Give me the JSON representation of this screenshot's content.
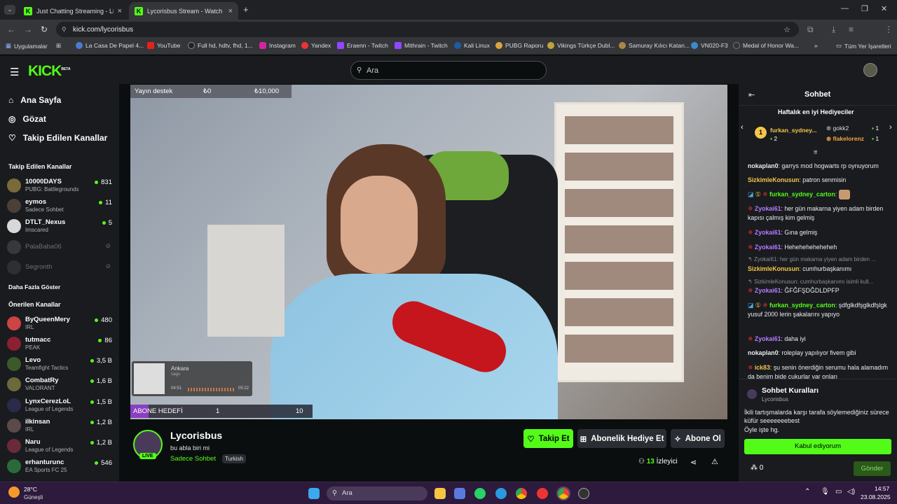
{
  "browser": {
    "tabs": [
      {
        "title": "Just Chatting Streaming - Live S",
        "active": false
      },
      {
        "title": "Lycorisbus Stream - Watch Live",
        "active": true
      }
    ],
    "url": "kick.com/lycorisbus",
    "bookmarks": [
      "Uygulamalar",
      "La Casa De Papel 4...",
      "YouTube",
      "Full hd, hdtv, fhd, 1...",
      "Instagram",
      "Yandex",
      "Eraenn - Twitch",
      "Mithrain - Twitch",
      "Kali Linux",
      "PUBG Raporu",
      "Vikings Türkçe Dubl...",
      "Samuray Kılıcı Katan...",
      "VN020-F3",
      "Medal of Honor Wa..."
    ],
    "bookmarks_more": "»",
    "all_bookmarks": "Tüm Yer İşaretleri"
  },
  "header": {
    "logo": "KICK",
    "logo_badge": "BETA",
    "search_placeholder": "Ara"
  },
  "sidebar": {
    "nav": [
      {
        "label": "Ana Sayfa",
        "icon": "home-icon"
      },
      {
        "label": "Gözat",
        "icon": "compass-icon"
      },
      {
        "label": "Takip Edilen Kanallar",
        "icon": "heart-icon"
      }
    ],
    "followed_title": "Takip Edilen Kanallar",
    "followed": [
      {
        "name": "10000DAYS",
        "category": "PUBG: Battlegrounds",
        "viewers": "831",
        "color": "#7a6a3a"
      },
      {
        "name": "eymos",
        "category": "Sadece Sohbet",
        "viewers": "11",
        "color": "#4a4036"
      },
      {
        "name": "DTLT_Nexus",
        "category": "Imscared",
        "viewers": "5",
        "color": "#d8d8d8"
      },
      {
        "name": "PalaBaba06",
        "category": "",
        "viewers": "",
        "color": "#555"
      },
      {
        "name": "Segronth",
        "category": "",
        "viewers": "",
        "color": "#444"
      }
    ],
    "show_more": "Daha Fazla Göster",
    "recommended_title": "Önerilen Kanallar",
    "recommended": [
      {
        "name": "ByQueenMery",
        "category": "IRL",
        "viewers": "480",
        "color": "#c44"
      },
      {
        "name": "tutmacc",
        "category": "PEAK",
        "viewers": "86",
        "color": "#8a2030"
      },
      {
        "name": "Levo",
        "category": "Teamfight Tactics",
        "viewers": "3,5 B",
        "color": "#3a5a2a"
      },
      {
        "name": "CombatRy",
        "category": "VALORANT",
        "viewers": "1,6 B",
        "color": "#6a6a3a"
      },
      {
        "name": "LynxCerezLoL",
        "category": "League of Legends",
        "viewers": "1,5 B",
        "color": "#2a2a4a"
      },
      {
        "name": "ilkinsan",
        "category": "IRL",
        "viewers": "1,2 B",
        "color": "#5a4a4a"
      },
      {
        "name": "Naru",
        "category": "League of Legends",
        "viewers": "1,2 B",
        "color": "#6a2a3a"
      },
      {
        "name": "erhanturunc",
        "category": "EA Sports FC 25",
        "viewers": "546",
        "color": "#2a6a3a"
      }
    ]
  },
  "video": {
    "donation_label": "Yayın destek",
    "donation_current": "₺0",
    "donation_goal": "₺10,000",
    "song_title": "Ankara",
    "song_artist": "sagu",
    "song_elapsed": "04:51",
    "song_total": "05:22",
    "sub_goal_label": "ABONE HEDEFİ",
    "sub_goal_current": "1",
    "sub_goal_target": "10"
  },
  "stream": {
    "channel": "Lycorisbus",
    "title": "bu abla biri mi",
    "category": "Sadece Sohbet",
    "language": "Turkish",
    "live_badge": "LIVE",
    "viewers": "13",
    "viewers_label": "İzleyici",
    "follow_btn": "Takip Et",
    "gift_btn": "Abonelik Hediye Et",
    "sub_btn": "Abone Ol"
  },
  "chat": {
    "title": "Sohbet",
    "gifters_title": "Haftalık en iyi Hediyeciler",
    "gifters": [
      {
        "rank": "1",
        "name": "furkan_sydney...",
        "count": "2"
      },
      {
        "name": "gokk2",
        "count": "1"
      },
      {
        "name": "flakelorenz",
        "count": "1"
      }
    ],
    "messages": [
      {
        "user": "nokaplan0",
        "color": "#e9ecef",
        "text": "garrys mod hogwarts rp oynuyorum"
      },
      {
        "user": "SizkimleKonusun",
        "color": "#f5c54a",
        "text": "patron senmisin"
      },
      {
        "user": "furkan_sydney_carton",
        "color": "#53fc18",
        "text": ""
      },
      {
        "user": "Zyokai61",
        "color": "#b47cff",
        "text": "her gün makarna yiyen adam birden kapısı çalmış kim gelmiş"
      },
      {
        "user": "Zyokai61",
        "color": "#b47cff",
        "text": "Gına gelmiş"
      },
      {
        "user": "Zyokai61",
        "color": "#b47cff",
        "text": "Hehehehehehehe​h"
      },
      {
        "reply": "Zyokai61: her gün makarna yiyen adam birden ..."
      },
      {
        "user": "SizkimleKonusun",
        "color": "#f5c54a",
        "text": "cumhurbaşkanımı"
      },
      {
        "reply": "SizkimleKonusun: cumhurbaşkanımı isimli kull..."
      },
      {
        "user": "Zyokai61",
        "color": "#b47cff",
        "text": "ĞFĞFŞDĞDLDPFP"
      },
      {
        "user": "furkan_sydney_carton",
        "color": "#53fc18",
        "text": "şdfglkdfşglkdfşlgk yusuf 2000 lerin şakalarını yapıyo"
      },
      {
        "user": "Zyokai61",
        "color": "#b47cff",
        "text": "daha iyi"
      },
      {
        "user": "nokaplan0",
        "color": "#e9ecef",
        "text": "roleplay yapılıyor fivem gibi"
      },
      {
        "user": "ick83",
        "color": "#f5c54a",
        "text": "şu senin önerdiğin serumu hala alamadım da benim bide çukurlar var onları"
      }
    ],
    "rules_title": "Sohbet Kuralları",
    "rules_channel": "Lycorisbus",
    "rules_text_1": "İkili tartışmalarda karşı tarafa söylemediğiniz sürece küfür seeeeeeebest",
    "rules_text_2": "Öyle işte hg.",
    "accept_btn": "Kabul ediyorum",
    "points": "0",
    "send_btn": "Gönder"
  },
  "taskbar": {
    "weather_temp": "28°C",
    "weather_desc": "Güneşli",
    "search_placeholder": "Ara",
    "time": "14:57",
    "date": "23.08.2025"
  }
}
